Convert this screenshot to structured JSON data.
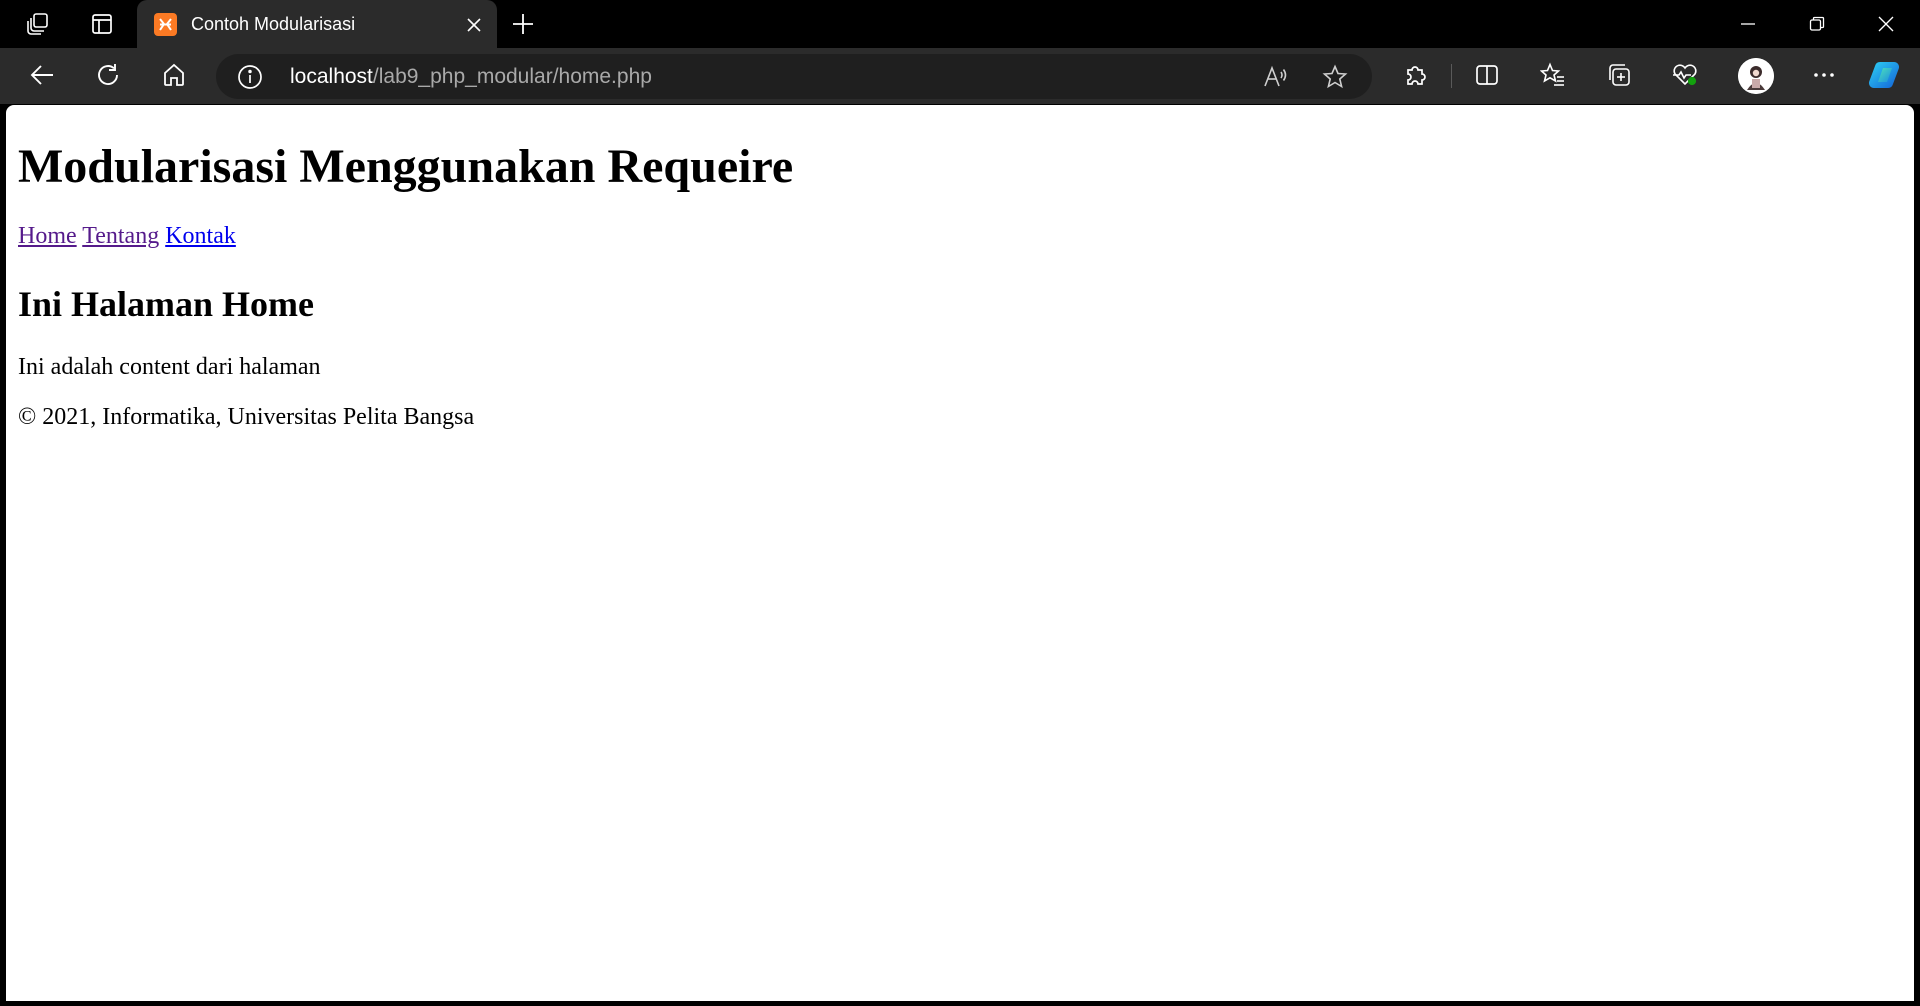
{
  "browser": {
    "tab": {
      "title": "Contoh Modularisasi",
      "favicon": "xampp-icon"
    },
    "address_bar": {
      "host": "localhost",
      "path": "/lab9_php_modular/home.php"
    },
    "icons": {
      "workspaces": "workspaces-icon",
      "vertical_tabs": "vertical-tabs-icon",
      "tab_close": "close-icon",
      "new_tab": "plus-icon",
      "minimize": "minimize-icon",
      "restore": "restore-icon",
      "close_window": "close-icon",
      "back": "back-arrow-icon",
      "refresh": "refresh-icon",
      "home": "home-icon",
      "site_info": "info-icon",
      "read_aloud": "read-aloud-icon",
      "favorite": "star-icon",
      "extensions": "puzzle-icon",
      "split_screen": "split-screen-icon",
      "favorites": "favorites-icon",
      "collections": "collections-icon",
      "performance": "heart-pulse-icon",
      "profile": "avatar",
      "more": "ellipsis-icon",
      "copilot": "copilot-icon"
    },
    "colors": {
      "titlebar": "#000000",
      "toolbar": "#2b2b2b",
      "address_field": "#1f1f1f",
      "favicon": "#fb7a24"
    }
  },
  "page": {
    "heading": "Modularisasi Menggunakan Requeire",
    "nav": [
      {
        "label": "Home",
        "visited": true
      },
      {
        "label": "Tentang",
        "visited": true
      },
      {
        "label": "Kontak",
        "visited": false
      }
    ],
    "section_heading": "Ini Halaman Home",
    "content": "Ini adalah content dari halaman",
    "footer": "© 2021, Informatika, Universitas Pelita Bangsa",
    "colors": {
      "visited_link": "#551a8b",
      "link": "#0000ee"
    }
  }
}
